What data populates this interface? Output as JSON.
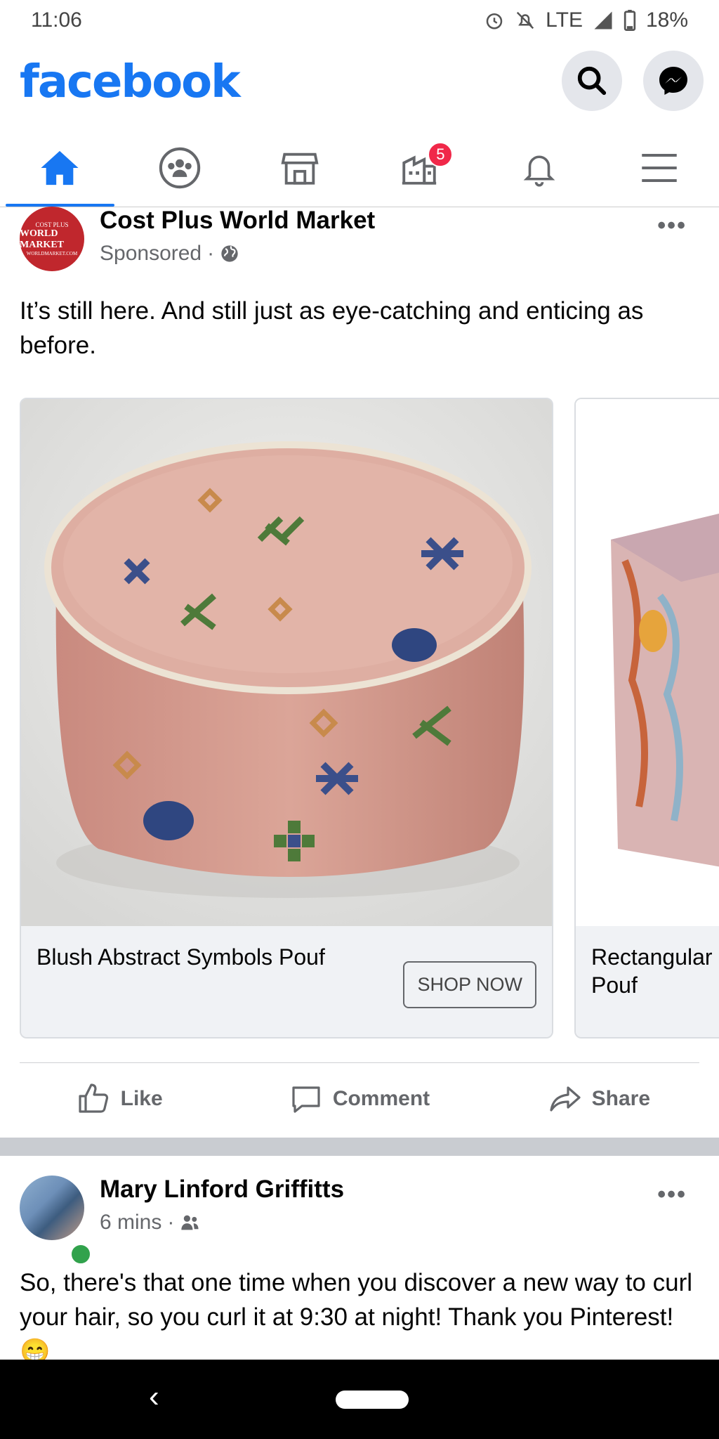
{
  "status_bar": {
    "time": "11:06",
    "network": "LTE",
    "battery": "18%"
  },
  "header": {
    "logo_text": "facebook",
    "brand_color": "#1877f2"
  },
  "nav_tabs": [
    {
      "name": "home",
      "icon": "home-icon",
      "active": true
    },
    {
      "name": "groups",
      "icon": "groups-icon",
      "active": false
    },
    {
      "name": "marketplace",
      "icon": "marketplace-icon",
      "active": false
    },
    {
      "name": "pages",
      "icon": "pages-icon",
      "active": false,
      "badge": "5"
    },
    {
      "name": "notifications",
      "icon": "bell-icon",
      "active": false
    },
    {
      "name": "menu",
      "icon": "menu-icon",
      "active": false
    }
  ],
  "post1": {
    "author": "Cost Plus World Market",
    "meta": "Sponsored",
    "logo_text": {
      "line1": "COST PLUS",
      "line2": "WORLD MARKET",
      "line3": "WORLDMARKET.COM"
    },
    "text": "It’s still here. And still just as eye-catching and enticing as before.",
    "cards": [
      {
        "title": "Blush Abstract Symbols Pouf",
        "button": "SHOP NOW"
      },
      {
        "title": "Rectangular Pouf"
      }
    ],
    "actions": {
      "like": "Like",
      "comment": "Comment",
      "share": "Share"
    }
  },
  "post2": {
    "author": "Mary Linford Griffitts",
    "meta": "6 mins",
    "text": "So, there's that one time when you discover a new way to curl your hair, so you curl it at 9:30 at night! Thank you Pinterest! 😁"
  }
}
